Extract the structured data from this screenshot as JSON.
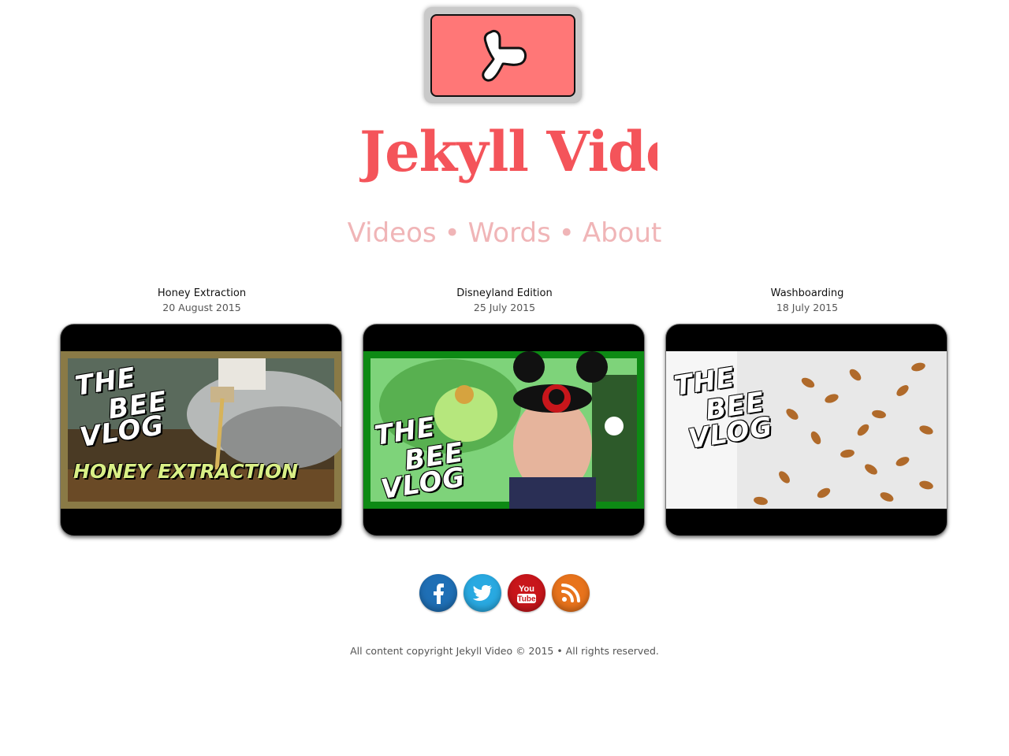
{
  "site": {
    "title": "Jekyll Video",
    "logo_color": "#ff7777",
    "title_color": "#f4545a"
  },
  "nav": {
    "items": [
      {
        "label": "Videos"
      },
      {
        "label": "Words"
      },
      {
        "label": "About"
      }
    ],
    "separator": "•",
    "color": "#f0b5b7"
  },
  "videos": [
    {
      "title": "Honey Extraction",
      "date": "20 August 2015",
      "thumb_text": [
        "THE",
        "BEE",
        "VLOG"
      ],
      "thumb_subtitle": "HONEY EXTRACTION",
      "frame_color": "#8a7a46"
    },
    {
      "title": "Disneyland Edition",
      "date": "25 July 2015",
      "thumb_text": [
        "THE",
        "BEE",
        "VLOG"
      ],
      "frame_color": "#0d8a14"
    },
    {
      "title": "Washboarding",
      "date": "18 July 2015",
      "thumb_text": [
        "THE",
        "BEE",
        "VLOG"
      ],
      "frame_color": "#e8e8e8"
    }
  ],
  "social": [
    {
      "name": "facebook-icon",
      "glyph": "f",
      "color": "#1f6fb5"
    },
    {
      "name": "twitter-icon",
      "glyph": "twitter-bird",
      "color": "#29a9e1"
    },
    {
      "name": "youtube-icon",
      "glyph_top": "You",
      "glyph_bottom": "Tube",
      "color": "#c8161b"
    },
    {
      "name": "rss-icon",
      "glyph": "rss",
      "color": "#e8731c"
    }
  ],
  "footer": {
    "text": "All content copyright Jekyll Video © 2015 • All rights reserved."
  }
}
